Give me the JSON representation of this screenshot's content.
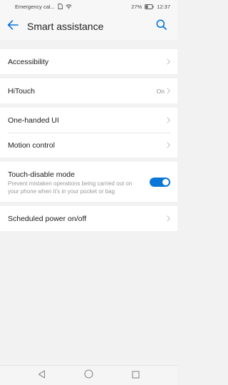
{
  "status_bar": {
    "carrier": "Emergency cal...",
    "battery": "27%",
    "time": "12:37"
  },
  "header": {
    "title": "Smart assistance",
    "back_icon": "arrow-left-icon",
    "search_icon": "search-icon"
  },
  "items": {
    "accessibility": {
      "label": "Accessibility"
    },
    "hitouch": {
      "label": "HiTouch",
      "value": "On"
    },
    "one_handed": {
      "label": "One-handed UI"
    },
    "motion": {
      "label": "Motion control"
    },
    "touch_disable": {
      "label": "Touch-disable mode",
      "description": "Prevent mistaken operations being carried out on your phone when it's in your pocket or bag",
      "enabled": true
    },
    "scheduled_power": {
      "label": "Scheduled power on/off"
    }
  },
  "colors": {
    "accent": "#0a76d8",
    "background": "#f2f2f2",
    "card": "#ffffff"
  },
  "nav_bar": {
    "icons": [
      "back-triangle-icon",
      "home-circle-icon",
      "recents-square-icon"
    ]
  }
}
